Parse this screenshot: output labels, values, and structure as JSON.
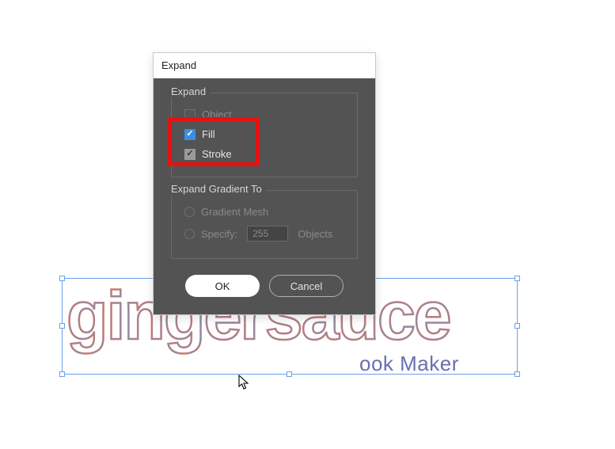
{
  "background": {
    "main_text": "gingersauce",
    "sub_text": "ook Maker"
  },
  "dialog": {
    "title": "Expand",
    "group_expand": {
      "label": "Expand",
      "object": {
        "label": "Object",
        "checked": false,
        "enabled": false
      },
      "fill": {
        "label": "Fill",
        "checked": true,
        "enabled": true
      },
      "stroke": {
        "label": "Stroke",
        "checked": true,
        "enabled": true
      }
    },
    "group_gradient": {
      "label": "Expand Gradient To",
      "gradient_mesh": {
        "label": "Gradient Mesh",
        "enabled": false
      },
      "specify": {
        "label": "Specify:",
        "value": "255",
        "unit": "Objects",
        "enabled": false
      }
    },
    "buttons": {
      "ok": "OK",
      "cancel": "Cancel"
    }
  }
}
